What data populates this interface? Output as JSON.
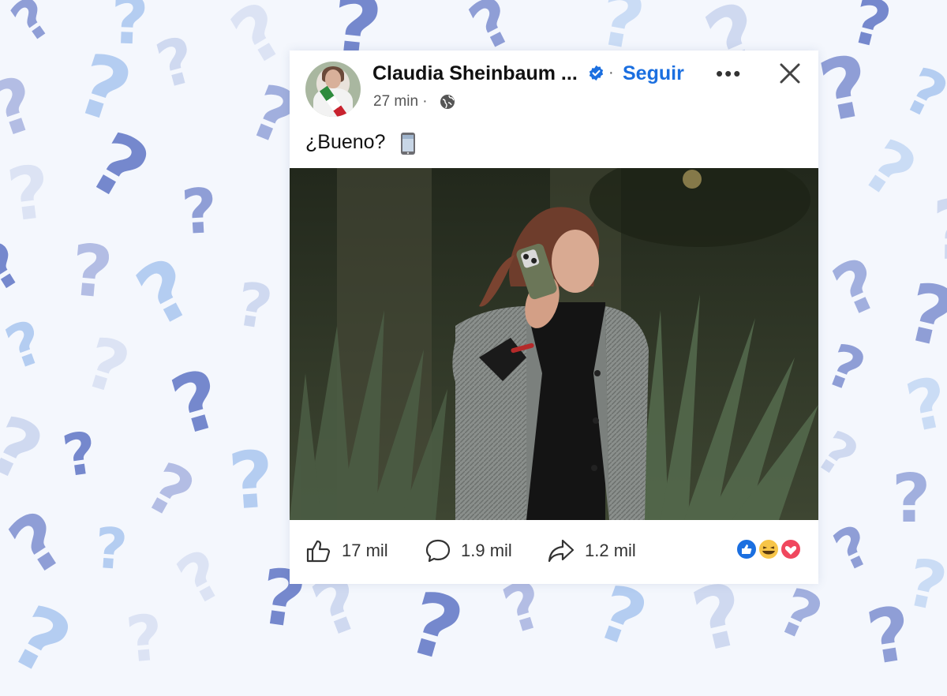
{
  "post": {
    "author": "Claudia Sheinbaum ...",
    "follow_label": "Seguir",
    "more_label": "•••",
    "time": "27 min ·",
    "text": "¿Bueno?"
  },
  "actions": {
    "like_count": "17 mil",
    "comment_count": "1.9 mil",
    "share_count": "1.2 mil"
  },
  "icons": {
    "verified": "verified-badge-icon",
    "globe": "globe-icon",
    "close": "close-icon",
    "like": "thumbs-up-icon",
    "comment": "comment-icon",
    "share": "share-icon",
    "phone": "mobile-phone-emoji"
  },
  "colors": {
    "accent": "#1b6fe0",
    "background": "#f4f7fd",
    "question_marks": [
      "#7e8fd0",
      "#a9c6f0",
      "#c9d4ee",
      "#5f75c5"
    ]
  }
}
